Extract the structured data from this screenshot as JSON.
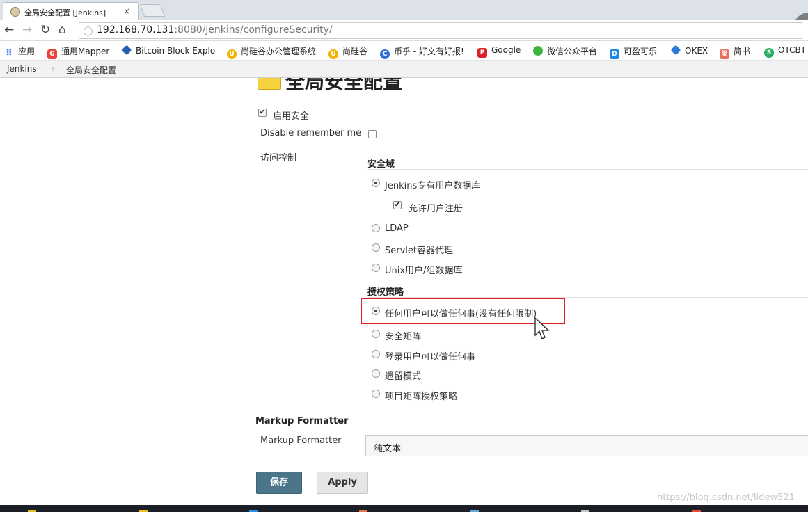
{
  "browser": {
    "tab_title": "全局安全配置 [Jenkins]",
    "tab_close": "×",
    "profile_badge": "4",
    "url_info_icon": "ⓘ",
    "url_host": "192.168.70.131",
    "url_path": ":8080/jenkins/configureSecurity/"
  },
  "bookmarks": [
    {
      "label": "应用",
      "icon": "apps-grid-icon",
      "color": "#3b78e7"
    },
    {
      "label": "通用Mapper",
      "icon": "g-logo-icon",
      "color": "#e8453c"
    },
    {
      "label": "Bitcoin Block Explo",
      "icon": "diamond-icon",
      "color": "#2a5fb0"
    },
    {
      "label": "尚硅谷办公管理系统",
      "icon": "u-logo-icon",
      "color": "#f0b400"
    },
    {
      "label": "尚硅谷",
      "icon": "u-logo-icon",
      "color": "#f0b400"
    },
    {
      "label": "币乎 - 好文有好报!",
      "icon": "c-logo-icon",
      "color": "#2f6fd6"
    },
    {
      "label": "Google",
      "icon": "p-logo-icon",
      "color": "#d9232d"
    },
    {
      "label": "微信公众平台",
      "icon": "wechat-icon",
      "color": "#3fb53f"
    },
    {
      "label": "可盈可乐",
      "icon": "square-logo-icon",
      "color": "#1e88e5"
    },
    {
      "label": "OKEX",
      "icon": "diamond-icon",
      "color": "#2a7ad6"
    },
    {
      "label": "简书",
      "icon": "jian-logo-icon",
      "color": "#ea6f5a"
    },
    {
      "label": "OTCBT",
      "icon": "circle-logo-icon",
      "color": "#27ae60"
    }
  ],
  "breadcrumb": {
    "root": "Jenkins",
    "separator": "›",
    "current": "全局安全配置"
  },
  "page": {
    "title": "全局安全配置",
    "enable_security": {
      "label": "启用安全",
      "checked": true
    },
    "disable_remember_me": {
      "label": "Disable remember me",
      "checked": false
    },
    "access_control_label": "访问控制",
    "security_realm": {
      "heading": "安全域",
      "options": [
        {
          "label": "Jenkins专有用户数据库",
          "selected": true
        },
        {
          "label": "LDAP",
          "selected": false
        },
        {
          "label": "Servlet容器代理",
          "selected": false
        },
        {
          "label": "Unix用户/组数据库",
          "selected": false
        }
      ],
      "allow_signup": {
        "label": "允许用户注册",
        "checked": true
      }
    },
    "authorization": {
      "heading": "授权策略",
      "options": [
        {
          "label": "任何用户可以做任何事(没有任何限制)",
          "selected": true
        },
        {
          "label": "安全矩阵",
          "selected": false
        },
        {
          "label": "登录用户可以做任何事",
          "selected": false
        },
        {
          "label": "遗留模式",
          "selected": false
        },
        {
          "label": "项目矩阵授权策略",
          "selected": false
        }
      ]
    },
    "markup_formatter": {
      "heading": "Markup Formatter",
      "label": "Markup Formatter",
      "value": "纯文本"
    },
    "buttons": {
      "save": "保存",
      "apply": "Apply"
    }
  },
  "watermark": "https://blog.csdn.net/lidew521"
}
